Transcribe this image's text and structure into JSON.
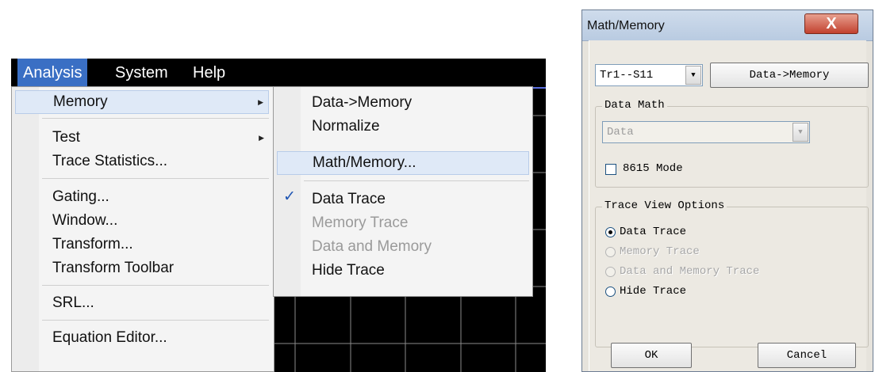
{
  "menubar": {
    "items": [
      "Analysis",
      "System",
      "Help"
    ],
    "active": "Analysis"
  },
  "analysis_menu": {
    "items": [
      {
        "label": "Memory",
        "submenu": true,
        "highlighted": true
      },
      {
        "label": "Test",
        "submenu": true
      },
      {
        "label": "Trace Statistics..."
      },
      {
        "label": "Gating..."
      },
      {
        "label": "Window..."
      },
      {
        "label": "Transform..."
      },
      {
        "label": "Transform Toolbar"
      },
      {
        "label": "SRL..."
      },
      {
        "label": "Equation Editor..."
      }
    ],
    "submenu_arrow": "▶"
  },
  "memory_submenu": {
    "items": [
      {
        "label": "Data->Memory"
      },
      {
        "label": "Normalize"
      },
      {
        "label": "Math/Memory...",
        "highlighted": true
      },
      {
        "label": "Data Trace",
        "checked": true
      },
      {
        "label": "Memory Trace",
        "disabled": true
      },
      {
        "label": "Data and Memory",
        "disabled": true
      },
      {
        "label": "Hide Trace"
      }
    ],
    "check_glyph": "✓"
  },
  "dialog": {
    "title": "Math/Memory",
    "close_glyph": "X",
    "trace_select": "Tr1--S11",
    "data_to_memory_button": "Data->Memory",
    "data_math": {
      "legend": "Data Math",
      "function_select": "Data",
      "mode_checkbox_label": "8615 Mode",
      "mode_checked": false
    },
    "trace_view": {
      "legend": "Trace View Options",
      "options": [
        {
          "label": "Data Trace",
          "selected": true,
          "disabled": false
        },
        {
          "label": "Memory Trace",
          "selected": false,
          "disabled": true
        },
        {
          "label": "Data and Memory Trace",
          "selected": false,
          "disabled": true
        },
        {
          "label": "Hide Trace",
          "selected": false,
          "disabled": false
        }
      ]
    },
    "ok_button": "OK",
    "cancel_button": "Cancel"
  },
  "colors": {
    "menu_active": "#3a6fc4",
    "highlight": "#dfe9f7",
    "check": "#1e55b3",
    "grid": "#8a8a8a",
    "close_button": "#c2412f"
  }
}
